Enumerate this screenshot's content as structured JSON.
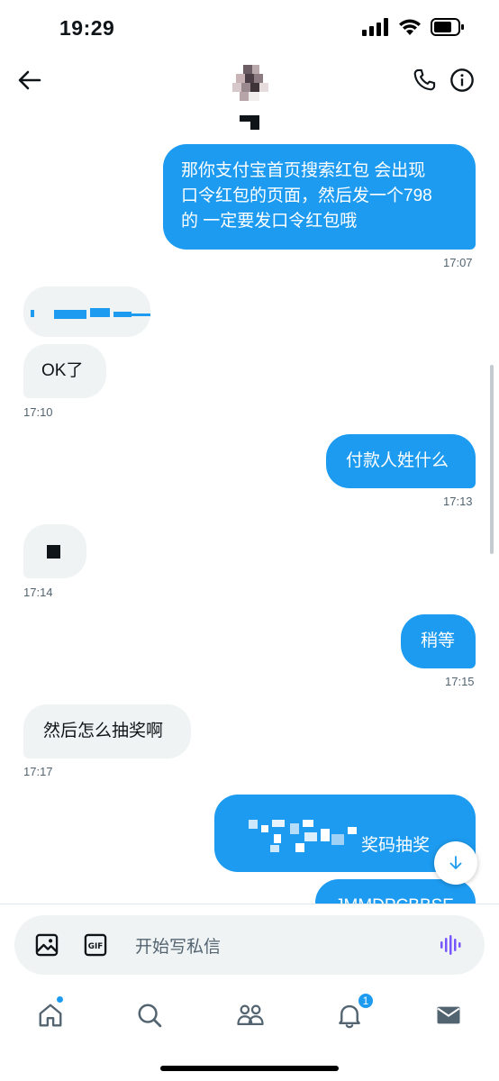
{
  "status_bar": {
    "time": "19:29"
  },
  "messages": [
    {
      "id": "m1",
      "text_lines": [
        "那你支付宝首页搜索红包 会出现",
        "口令红包的页面，然后发一个798",
        "的 一定要发口令红包哦"
      ],
      "time": "17:07"
    },
    {
      "id": "m3",
      "text": "OK了",
      "time": "17:10"
    },
    {
      "id": "m4",
      "text": "付款人姓什么",
      "time": "17:13"
    },
    {
      "id": "m5",
      "time": "17:14"
    },
    {
      "id": "m6",
      "text": "稍等",
      "time": "17:15"
    },
    {
      "id": "m7",
      "text": "然后怎么抽奖啊",
      "time": "17:17"
    },
    {
      "id": "m8",
      "text": "奖码抽奖"
    },
    {
      "id": "m9",
      "text": "JMMDPCBBSE"
    }
  ],
  "composer": {
    "placeholder": "开始写私信"
  },
  "nav": {
    "notifications_count": "1"
  },
  "colors": {
    "accent": "#1d9bf0",
    "incoming_bubble": "#eff3f4",
    "voice_icon": "#7856ff"
  },
  "icons": [
    "back-arrow-icon",
    "phone-icon",
    "info-icon",
    "image-icon",
    "gif-icon",
    "voice-wave-icon",
    "home-icon",
    "search-icon",
    "people-icon",
    "bell-icon",
    "mail-icon",
    "arrow-down-icon"
  ]
}
